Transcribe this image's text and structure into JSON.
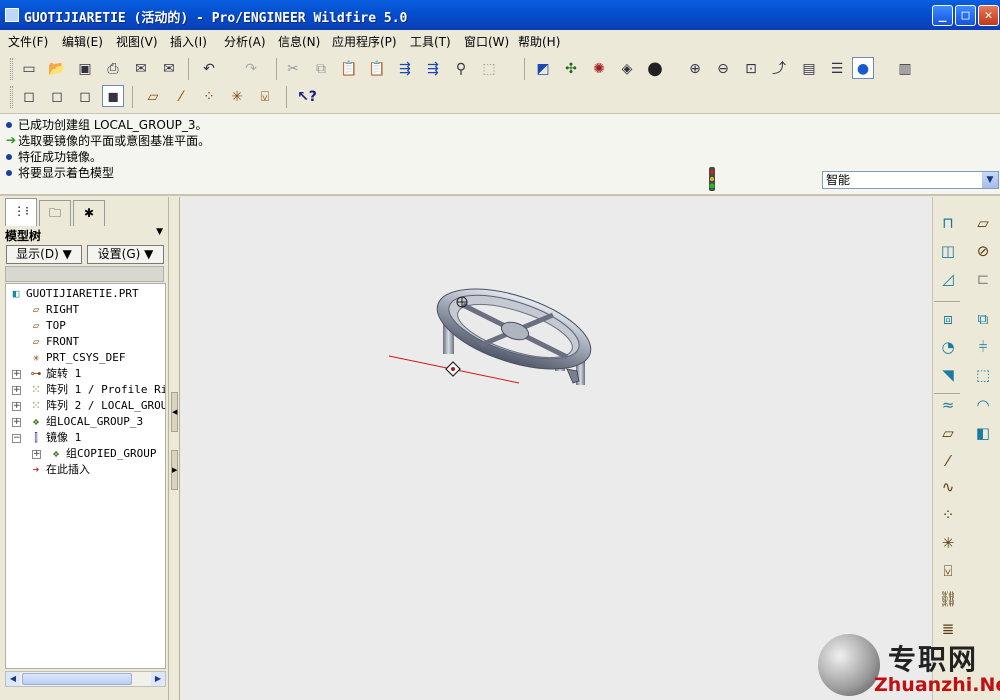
{
  "window": {
    "title": "GUOTIJIARETIE (活动的) - Pro/ENGINEER Wildfire 5.0",
    "minimize": "_",
    "maximize": "□",
    "close": "✕"
  },
  "menu": [
    "文件(F)",
    "编辑(E)",
    "视图(V)",
    "插入(I)",
    "分析(A)",
    "信息(N)",
    "应用程序(P)",
    "工具(T)",
    "窗口(W)",
    "帮助(H)"
  ],
  "toolbar_row1_icons": [
    "new-file-icon",
    "open-folder-icon",
    "save-icon",
    "print-icon",
    "send-mail-icon",
    "mail-icon",
    "undo-icon",
    "redo-icon",
    "cut-icon",
    "copy-icon",
    "paste-icon",
    "paste-special-icon",
    "regenerate-icon",
    "regen-manager-icon",
    "find-icon",
    "select-box-icon",
    "repaint-icon",
    "spin-center-icon",
    "orient-mode-icon",
    "zoom-to-fit-view-icon",
    "shading-sphere-icon",
    "zoom-in-icon",
    "zoom-out-icon",
    "refit-icon",
    "reorient-icon",
    "saved-views-icon",
    "layers-icon",
    "appearance-icon",
    "view-manager-icon"
  ],
  "toolbar_row2_icons": [
    "wireframe-icon",
    "hidden-line-icon",
    "no-hidden-icon",
    "shading-icon",
    "datum-plane-display-icon",
    "datum-axis-display-icon",
    "datum-point-display-icon",
    "csys-display-icon",
    "annotation-display-icon",
    "context-help-icon"
  ],
  "messages": [
    {
      "type": "info",
      "text": "已成功创建组 LOCAL_GROUP_3。"
    },
    {
      "type": "prompt",
      "text": "选取要镜像的平面或意图基准平面。"
    },
    {
      "type": "info",
      "text": "特征成功镜像。"
    },
    {
      "type": "info",
      "text": "将要显示着色模型"
    }
  ],
  "filter": {
    "value": "智能"
  },
  "left_panel": {
    "tabs": [
      "model-tree-tab",
      "folder-browser-tab",
      "favorites-tab"
    ],
    "header": "模型树",
    "show_button": "显示(D) ▼",
    "settings_button": "设置(G) ▼",
    "tree": [
      {
        "label": "GUOTIJIARETIE.PRT",
        "icon": "part-icon",
        "level": 0,
        "expand": ""
      },
      {
        "label": "RIGHT",
        "icon": "datum-plane-icon",
        "level": 1,
        "expand": ""
      },
      {
        "label": "TOP",
        "icon": "datum-plane-icon",
        "level": 1,
        "expand": ""
      },
      {
        "label": "FRONT",
        "icon": "datum-plane-icon",
        "level": 1,
        "expand": ""
      },
      {
        "label": "PRT_CSYS_DEF",
        "icon": "csys-icon",
        "level": 1,
        "expand": ""
      },
      {
        "label": "旋转 1",
        "icon": "revolve-icon",
        "level": 1,
        "expand": "+"
      },
      {
        "label": "阵列 1 / Profile Ri",
        "icon": "pattern-icon",
        "level": 1,
        "expand": "+"
      },
      {
        "label": "阵列 2 / LOCAL_GROU",
        "icon": "pattern-icon",
        "level": 1,
        "expand": "+"
      },
      {
        "label": "组LOCAL_GROUP_3",
        "icon": "group-icon",
        "level": 1,
        "expand": "+"
      },
      {
        "label": "镜像 1",
        "icon": "mirror-icon",
        "level": 1,
        "expand": "−"
      },
      {
        "label": "组COPIED_GROUP",
        "icon": "group-icon",
        "level": 2,
        "expand": "+"
      },
      {
        "label": "在此插入",
        "icon": "insert-here-icon",
        "level": 1,
        "expand": ""
      }
    ]
  },
  "right_toolbar_icons": [
    "datum-plane-tool-icon",
    "sketch-tool-icon",
    "datum-axis-tool-icon",
    "datum-curve-tool-icon",
    "datum-point-tool-icon",
    "csys-tool-icon",
    "analysis-tool-icon",
    "extrude-icon",
    "revolve-tool-icon",
    "sweep-icon",
    "hole-icon",
    "round-icon",
    "chamfer-icon",
    "rib-icon",
    "draft-icon",
    "shell-icon",
    "pattern-tool-icon",
    "mirror-tool-icon",
    "merge-icon",
    "trim-icon",
    "offset-icon",
    "thicken-icon",
    "solidify-icon"
  ],
  "watermark": {
    "cn": "专职网",
    "en": "Zhuanzhi.Net"
  }
}
